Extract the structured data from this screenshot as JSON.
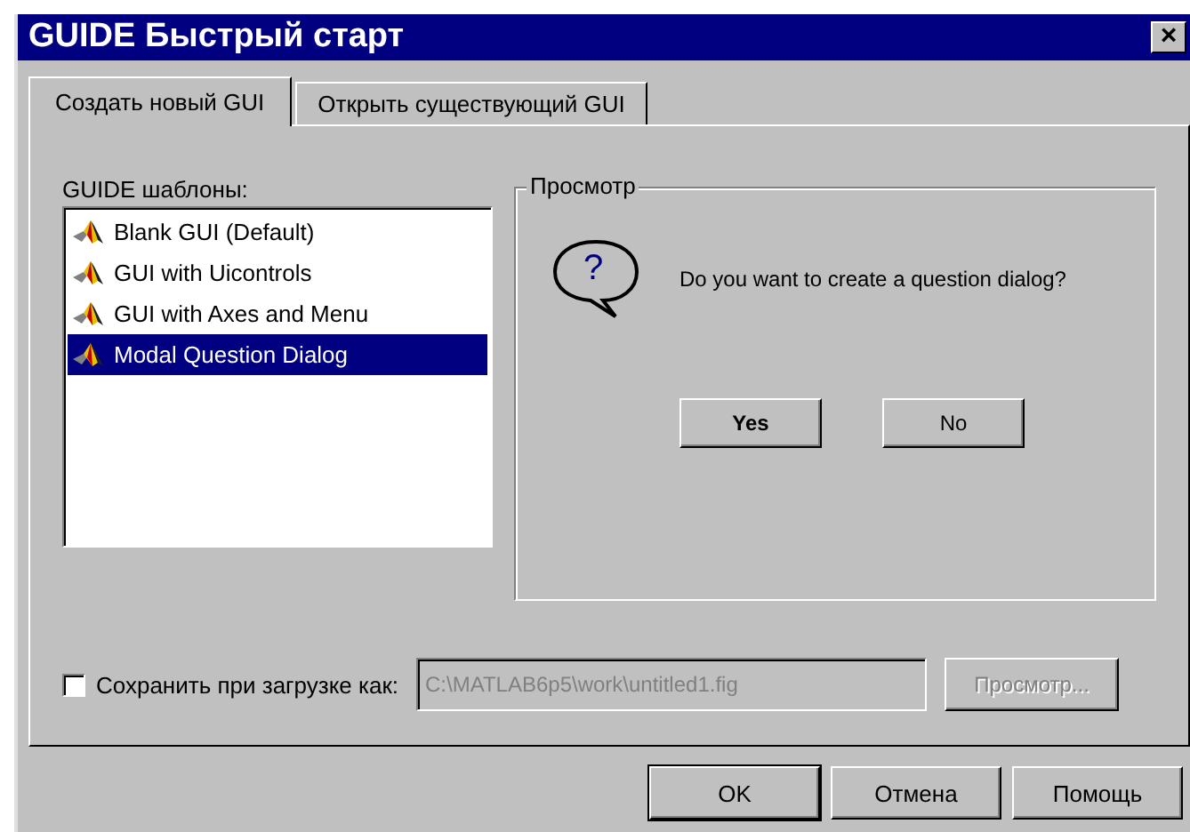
{
  "window": {
    "title": "GUIDE Быстрый старт",
    "close": "×"
  },
  "tabs": [
    {
      "label": "Создать новый GUI",
      "selected": true
    },
    {
      "label": "Открыть существующий GUI",
      "selected": false
    }
  ],
  "templates": {
    "label": "GUIDE шаблоны:",
    "items": [
      {
        "label": "Blank GUI (Default)",
        "selected": false
      },
      {
        "label": "GUI with Uicontrols",
        "selected": false
      },
      {
        "label": "GUI with Axes and Menu",
        "selected": false
      },
      {
        "label": "Modal Question Dialog",
        "selected": true
      }
    ]
  },
  "preview": {
    "title": "Просмотр",
    "question": "?",
    "message": "Do you want to create a question dialog?",
    "buttons": [
      {
        "label": "Yes",
        "default": true
      },
      {
        "label": "No",
        "default": false
      }
    ]
  },
  "save": {
    "label": "Сохранить при загрузке как:",
    "checked": false,
    "path": "C:\\MATLAB6p5\\work\\untitled1.fig",
    "disabled": true,
    "browse": "Просмотр...",
    "browse_disabled": true
  },
  "buttons": [
    {
      "label": "OK",
      "default": true
    },
    {
      "label": "Отмена",
      "default": false
    },
    {
      "label": "Помощь",
      "default": false
    }
  ]
}
